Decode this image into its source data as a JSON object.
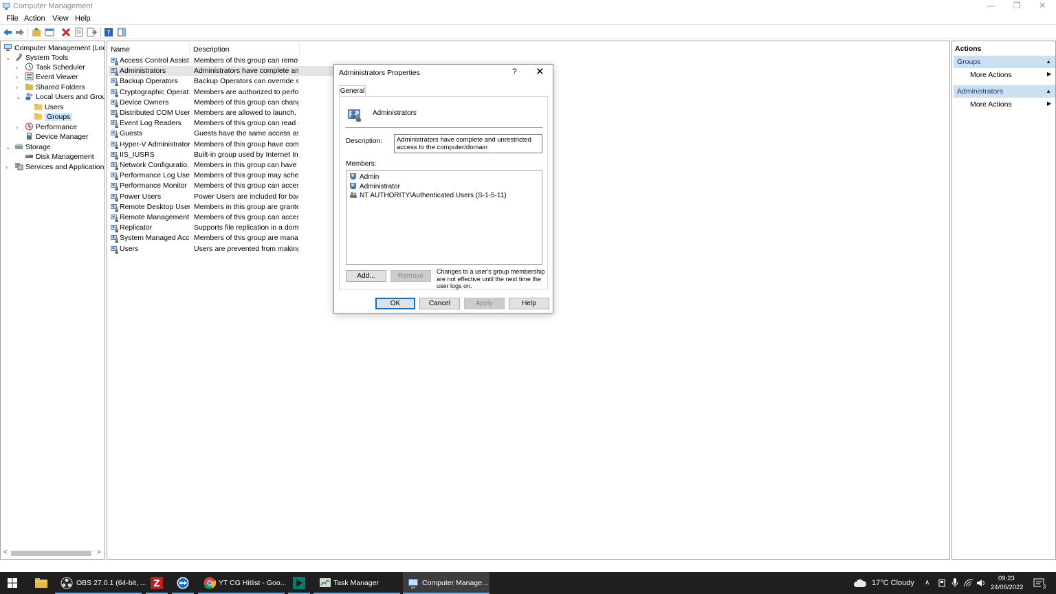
{
  "window": {
    "title": "Computer Management",
    "minimize": "—",
    "restore": "❐",
    "close": "✕"
  },
  "menu": [
    "File",
    "Action",
    "View",
    "Help"
  ],
  "tree": {
    "root": "Computer Management (Local",
    "items": [
      {
        "label": "System Tools",
        "exp": "⌄"
      },
      {
        "label": "Task Scheduler",
        "exp": "›"
      },
      {
        "label": "Event Viewer",
        "exp": "›"
      },
      {
        "label": "Shared Folders",
        "exp": "›"
      },
      {
        "label": "Local Users and Groups",
        "exp": "⌄"
      },
      {
        "label": "Users",
        "exp": ""
      },
      {
        "label": "Groups",
        "exp": ""
      },
      {
        "label": "Performance",
        "exp": "›"
      },
      {
        "label": "Device Manager",
        "exp": ""
      },
      {
        "label": "Storage",
        "exp": "⌄"
      },
      {
        "label": "Disk Management",
        "exp": ""
      },
      {
        "label": "Services and Applications",
        "exp": "›"
      }
    ]
  },
  "list": {
    "headers": {
      "name": "Name",
      "description": "Description"
    },
    "rows": [
      {
        "name": "Access Control Assist...",
        "desc": "Members of this group can remot..."
      },
      {
        "name": "Administrators",
        "desc": "Administrators have complete an..."
      },
      {
        "name": "Backup Operators",
        "desc": "Backup Operators can override se..."
      },
      {
        "name": "Cryptographic Operat...",
        "desc": "Members are authorized to perfor..."
      },
      {
        "name": "Device Owners",
        "desc": "Members of this group can chang..."
      },
      {
        "name": "Distributed COM Users",
        "desc": "Members are allowed to launch, a..."
      },
      {
        "name": "Event Log Readers",
        "desc": "Members of this group can read e..."
      },
      {
        "name": "Guests",
        "desc": "Guests have the same access as m..."
      },
      {
        "name": "Hyper-V Administrators",
        "desc": "Members of this group have com..."
      },
      {
        "name": "IIS_IUSRS",
        "desc": "Built-in group used by Internet Inf..."
      },
      {
        "name": "Network Configuratio...",
        "desc": "Members in this group can have s..."
      },
      {
        "name": "Performance Log Users",
        "desc": "Members of this group may sche..."
      },
      {
        "name": "Performance Monitor ...",
        "desc": "Members of this group can acces..."
      },
      {
        "name": "Power Users",
        "desc": "Power Users are included for back..."
      },
      {
        "name": "Remote Desktop Users",
        "desc": "Members in this group are grante..."
      },
      {
        "name": "Remote Management...",
        "desc": "Members of this group can acces..."
      },
      {
        "name": "Replicator",
        "desc": "Supports file replication in a dom..."
      },
      {
        "name": "System Managed Acc...",
        "desc": "Members of this group are mana..."
      },
      {
        "name": "Users",
        "desc": "Users are prevented from making ..."
      }
    ]
  },
  "actions": {
    "title": "Actions",
    "sections": [
      {
        "header": "Groups",
        "item": "More Actions"
      },
      {
        "header": "Administrators",
        "item": "More Actions"
      }
    ]
  },
  "dialog": {
    "title": "Administrators Properties",
    "help": "?",
    "close": "✕",
    "tab": "General",
    "group_name": "Administrators",
    "description_label": "Description:",
    "description": "Administrators have complete and unrestricted access to the computer/domain",
    "members_label": "Members:",
    "members": [
      "Admin",
      "Administrator",
      "NT AUTHORITY\\Authenticated Users (S-1-5-11)"
    ],
    "add": "Add...",
    "remove": "Remove",
    "note": "Changes to a user's group membership are not effective until the next time the user logs on.",
    "ok": "OK",
    "cancel": "Cancel",
    "apply": "Apply",
    "help_btn": "Help"
  },
  "taskbar": {
    "apps": [
      {
        "label": "OBS 27.0.1 (64-bit, ..."
      },
      {
        "label": "YT CG Hitlist - Goo..."
      },
      {
        "label": "Task Manager"
      },
      {
        "label": "Computer Manage..."
      }
    ],
    "weather": "17°C  Cloudy",
    "time": "09:23",
    "date": "24/06/2022",
    "notifications": "3"
  }
}
